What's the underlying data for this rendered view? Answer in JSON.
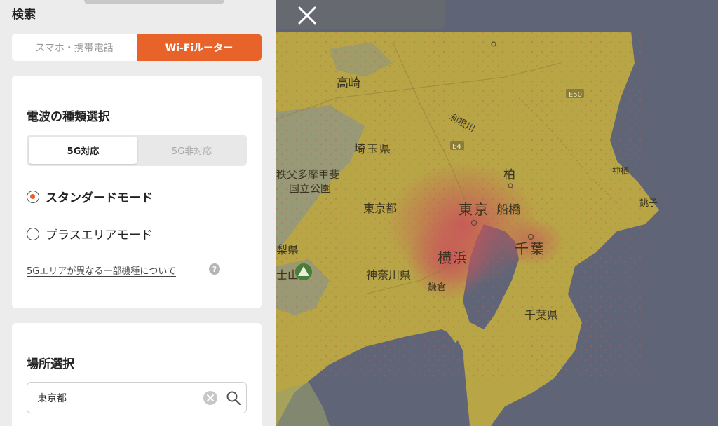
{
  "panel": {
    "title": "検索",
    "device_tabs": [
      {
        "label": "スマホ・携帯電話",
        "active": false
      },
      {
        "label": "Wi-Fiルーター",
        "active": true
      }
    ],
    "wave_section": {
      "title": "電波の種類選択",
      "g5_options": [
        {
          "label": "5G対応",
          "selected": true
        },
        {
          "label": "5G非対応",
          "selected": false
        }
      ],
      "modes": [
        {
          "label": "スタンダードモード",
          "checked": true
        },
        {
          "label": "プラスエリアモード",
          "checked": false
        }
      ],
      "info_link": "5Gエリアが異なる一部機種について",
      "help_icon": "?"
    },
    "place_section": {
      "title": "場所選択",
      "search_value": "東京都"
    }
  },
  "map": {
    "labels": {
      "takasaki": "高崎",
      "saitama_pref": "埼玉県",
      "chichibu_1": "秩父多摩甲斐",
      "chichibu_2": "国立公園",
      "tokyo_to": "東京都",
      "tokyo": "東京",
      "funabashi": "船橋",
      "kashiwa": "柏",
      "chiba": "千葉",
      "chiba_pref": "千葉県",
      "yokohama": "横浜",
      "kanagawa_pref": "神奈川県",
      "kamakura": "鎌倉",
      "yamanashi_pref": "梨県",
      "fuji_partial": "士山",
      "kamisu": "神栖",
      "choshi": "銚子",
      "tonegawa": "利根川",
      "e50": "E50",
      "e4": "E4"
    }
  },
  "colors": {
    "accent": "#e8632a",
    "sea": "#5f6577",
    "land": "#b8a646"
  },
  "icons": {
    "close": "close-icon",
    "clear": "clear-circle-icon",
    "search": "search-icon",
    "help": "help-icon",
    "mountain": "mountain-icon"
  }
}
